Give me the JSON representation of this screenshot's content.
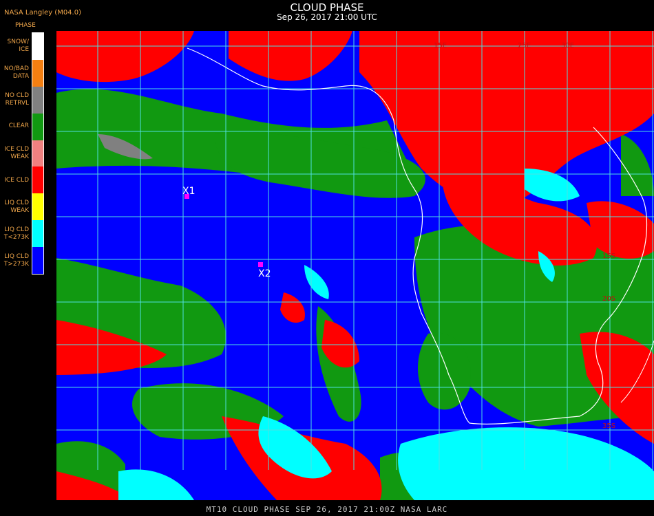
{
  "header": {
    "agency": "NASA Langley (M04.0)",
    "legend_title": "PHASE",
    "title": "CLOUD PHASE",
    "subtitle": "Sep 26, 2017 21:00 UTC"
  },
  "legend": {
    "items": [
      {
        "label": "SNOW/\nICE",
        "color": "#ffffff"
      },
      {
        "label": "NO/BAD\nDATA",
        "color": "#f47f11"
      },
      {
        "label": "NO CLD\nRETRVL",
        "color": "#808080"
      },
      {
        "label": "CLEAR",
        "color": "#119911"
      },
      {
        "label": "ICE CLD\nWEAK",
        "color": "#f08080"
      },
      {
        "label": "ICE CLD",
        "color": "#ff0000"
      },
      {
        "label": "LIQ CLD\nWEAK",
        "color": "#ffff00"
      },
      {
        "label": "LIQ CLD\nT<273K",
        "color": "#00ffff"
      },
      {
        "label": "LIQ CLD\nT>273K",
        "color": "#0000ff"
      }
    ]
  },
  "markers": [
    {
      "label": "X1"
    },
    {
      "label": "X2"
    }
  ],
  "grid_labels": [
    "15E",
    "25E",
    "30E",
    "15S",
    "20S",
    "35S"
  ],
  "footer": "MT10  CLOUD PHASE  SEP 26, 2017 21:00Z  NASA LARC",
  "colors": {
    "ocean_liquid": "#0000ff",
    "clear": "#119911",
    "ice": "#ff0000",
    "liquid_cold": "#00ffff",
    "grid": "#4fe0e0",
    "coast": "#ffffff"
  }
}
